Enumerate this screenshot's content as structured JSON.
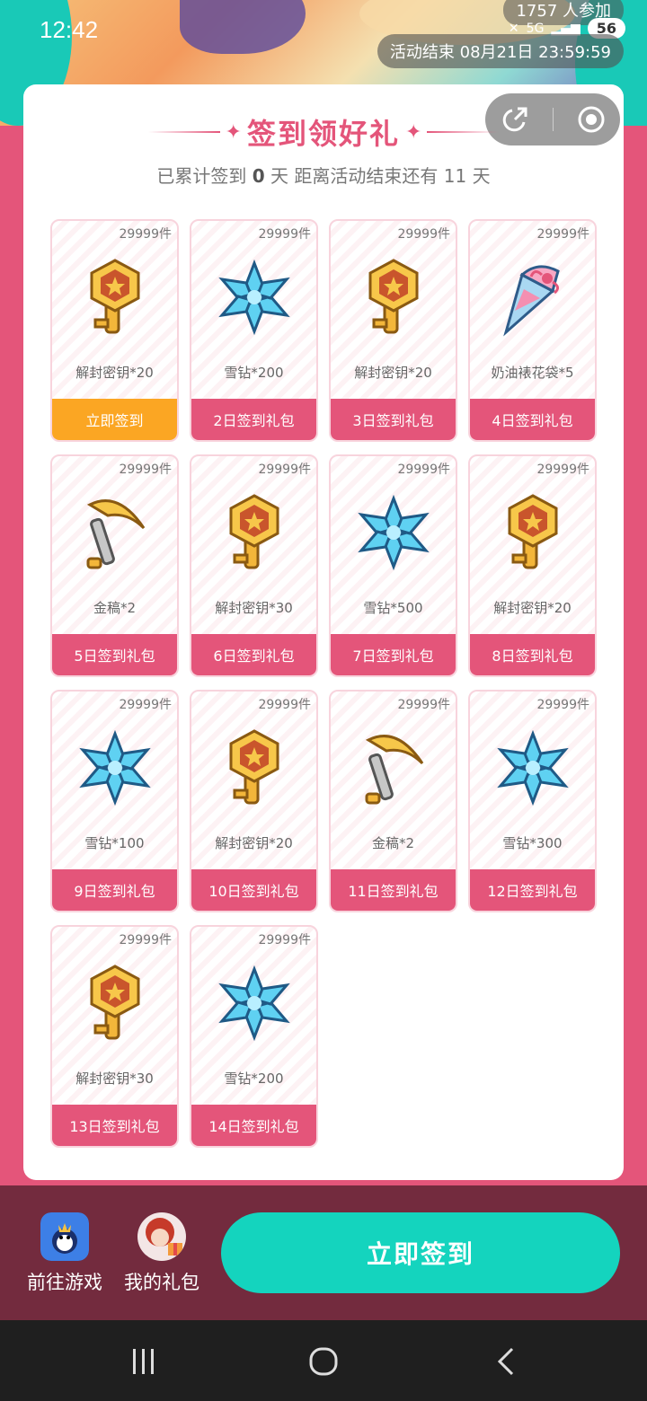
{
  "status": {
    "time": "12:42",
    "network": "5G",
    "battery": "56"
  },
  "banner": {
    "participants": "1757 人参加",
    "activity_end": "活动结束 08月21日 23:59:59"
  },
  "title": "签到领好礼",
  "subtitle": {
    "prefix": "已累计签到",
    "count": "0",
    "mid": "天  距离活动结束还有 11 天"
  },
  "rewards": [
    {
      "stock": "29999件",
      "name": "解封密钥*20",
      "button": "立即签到",
      "icon": "key-icon",
      "active": true
    },
    {
      "stock": "29999件",
      "name": "雪钻*200",
      "button": "2日签到礼包",
      "icon": "snow-diamond-icon"
    },
    {
      "stock": "29999件",
      "name": "解封密钥*20",
      "button": "3日签到礼包",
      "icon": "key-icon"
    },
    {
      "stock": "29999件",
      "name": "奶油裱花袋*5",
      "button": "4日签到礼包",
      "icon": "piping-bag-icon"
    },
    {
      "stock": "29999件",
      "name": "金稿*2",
      "button": "5日签到礼包",
      "icon": "pickaxe-icon"
    },
    {
      "stock": "29999件",
      "name": "解封密钥*30",
      "button": "6日签到礼包",
      "icon": "key-icon"
    },
    {
      "stock": "29999件",
      "name": "雪钻*500",
      "button": "7日签到礼包",
      "icon": "snow-diamond-icon"
    },
    {
      "stock": "29999件",
      "name": "解封密钥*20",
      "button": "8日签到礼包",
      "icon": "key-icon"
    },
    {
      "stock": "29999件",
      "name": "雪钻*100",
      "button": "9日签到礼包",
      "icon": "snow-diamond-icon"
    },
    {
      "stock": "29999件",
      "name": "解封密钥*20",
      "button": "10日签到礼包",
      "icon": "key-icon"
    },
    {
      "stock": "29999件",
      "name": "金稿*2",
      "button": "11日签到礼包",
      "icon": "pickaxe-icon"
    },
    {
      "stock": "29999件",
      "name": "雪钻*300",
      "button": "12日签到礼包",
      "icon": "snow-diamond-icon"
    },
    {
      "stock": "29999件",
      "name": "解封密钥*30",
      "button": "13日签到礼包",
      "icon": "key-icon"
    },
    {
      "stock": "29999件",
      "name": "雪钻*200",
      "button": "14日签到礼包",
      "icon": "snow-diamond-icon"
    }
  ],
  "bottom": {
    "go_game": "前往游戏",
    "my_gifts": "我的礼包",
    "sign_in": "立即签到"
  },
  "colors": {
    "accent": "#e4557a",
    "active_button": "#fba623",
    "primary_button": "#14d4be"
  }
}
